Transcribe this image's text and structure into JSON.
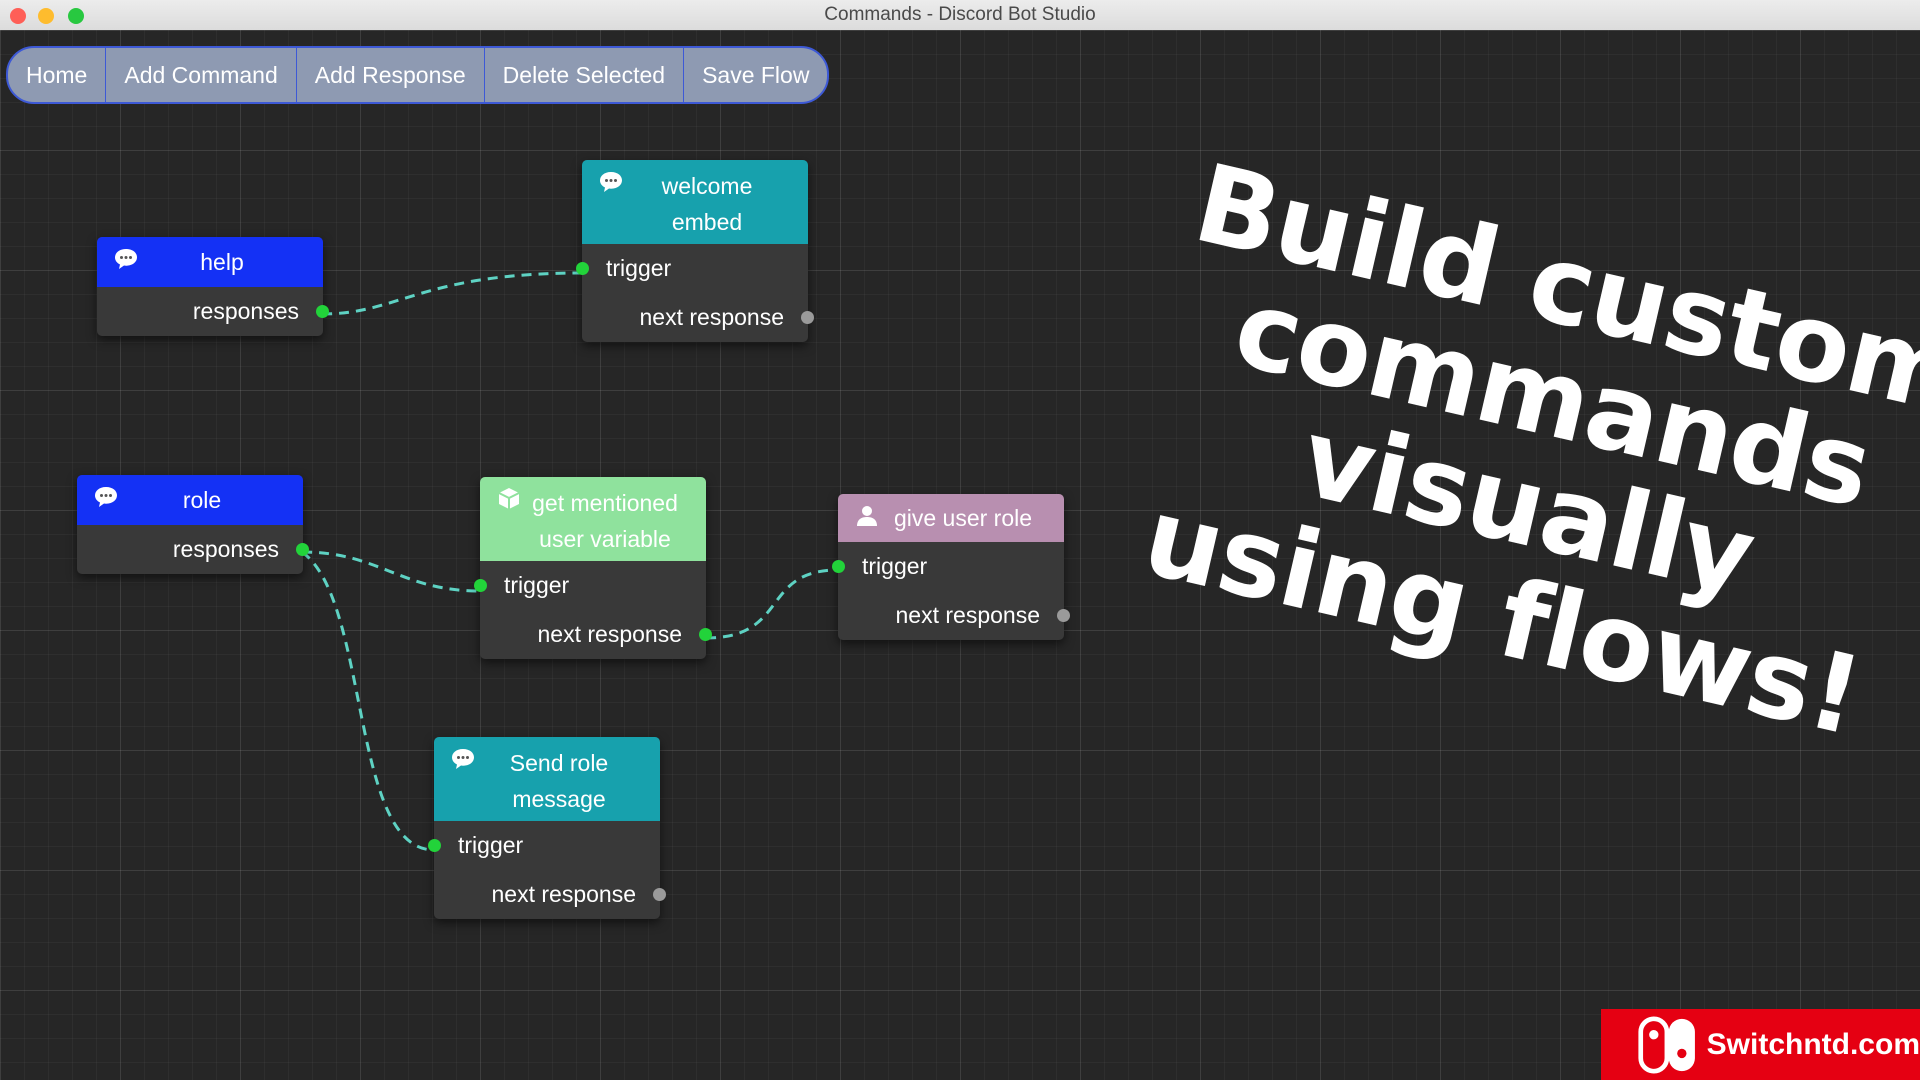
{
  "window": {
    "title": "Commands - Discord Bot Studio"
  },
  "toolbar": {
    "home": "Home",
    "add_command": "Add Command",
    "add_response": "Add Response",
    "delete_selected": "Delete Selected",
    "save_flow": "Save Flow"
  },
  "nodes": {
    "help": {
      "title": "help",
      "output": "responses",
      "color": "#1431f5"
    },
    "welcome": {
      "title": "welcome embed",
      "input": "trigger",
      "output": "next response",
      "color": "#17a1ad"
    },
    "role": {
      "title": "role",
      "output": "responses",
      "color": "#1431f5"
    },
    "mention": {
      "title": "get mentioned user variable",
      "input": "trigger",
      "output": "next response",
      "color": "#8fe29d"
    },
    "give_role": {
      "title": "give user role",
      "input": "trigger",
      "output": "next response",
      "color": "#b88fb0"
    },
    "send_role": {
      "title": "Send role message",
      "input": "trigger",
      "output": "next response",
      "color": "#17a1ad"
    }
  },
  "port_colors": {
    "connected": "#22d33a",
    "empty": "#9a9a9a",
    "wire": "#5ed2c3"
  },
  "icons": {
    "help": "chat-bubble-icon",
    "welcome": "chat-bubble-icon",
    "role": "chat-bubble-icon",
    "mention": "cube-icon",
    "give_role": "user-icon",
    "send_role": "chat-bubble-icon"
  },
  "headline": {
    "line1": "Build custom",
    "line2": "commands visually",
    "line3": "using flows!"
  },
  "badge": {
    "text": "Switchntd.com"
  }
}
